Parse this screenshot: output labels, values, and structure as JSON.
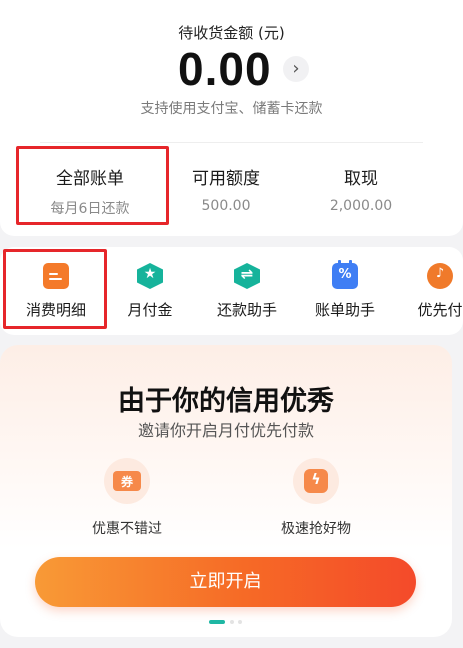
{
  "balance": {
    "label": "待收货金额 (元)",
    "amount": "0.00",
    "arrow": "›",
    "subtitle": "支持使用支付宝、储蓄卡还款"
  },
  "stats": [
    {
      "title": "全部账单",
      "value": "每月6日还款"
    },
    {
      "title": "可用额度",
      "value": "500.00"
    },
    {
      "title": "取现",
      "value": "2,000.00"
    }
  ],
  "services": [
    {
      "label": "消费明细",
      "icon": "bill-detail-icon"
    },
    {
      "label": "月付金",
      "icon": "star-hexagon-icon",
      "glyph": "★"
    },
    {
      "label": "还款助手",
      "icon": "exchange-hexagon-icon",
      "glyph": "⇌"
    },
    {
      "label": "账单助手",
      "icon": "calendar-percent-icon",
      "glyph": "%"
    },
    {
      "label": "优先付",
      "icon": "tiktok-icon",
      "glyph": "♪"
    }
  ],
  "promo": {
    "title": "由于你的信用优秀",
    "subtitle": "邀请你开启月付优先付款",
    "features": [
      {
        "label": "优惠不错过",
        "icon": "coupon-icon",
        "glyph": "券"
      },
      {
        "label": "极速抢好物",
        "icon": "lightning-bag-icon",
        "glyph": "ϟ"
      }
    ],
    "cta": "立即开启"
  },
  "colors": {
    "accent": "#f66a26",
    "highlight": "#e6262a",
    "teal": "#16b39b",
    "blue": "#3f7ef4"
  }
}
